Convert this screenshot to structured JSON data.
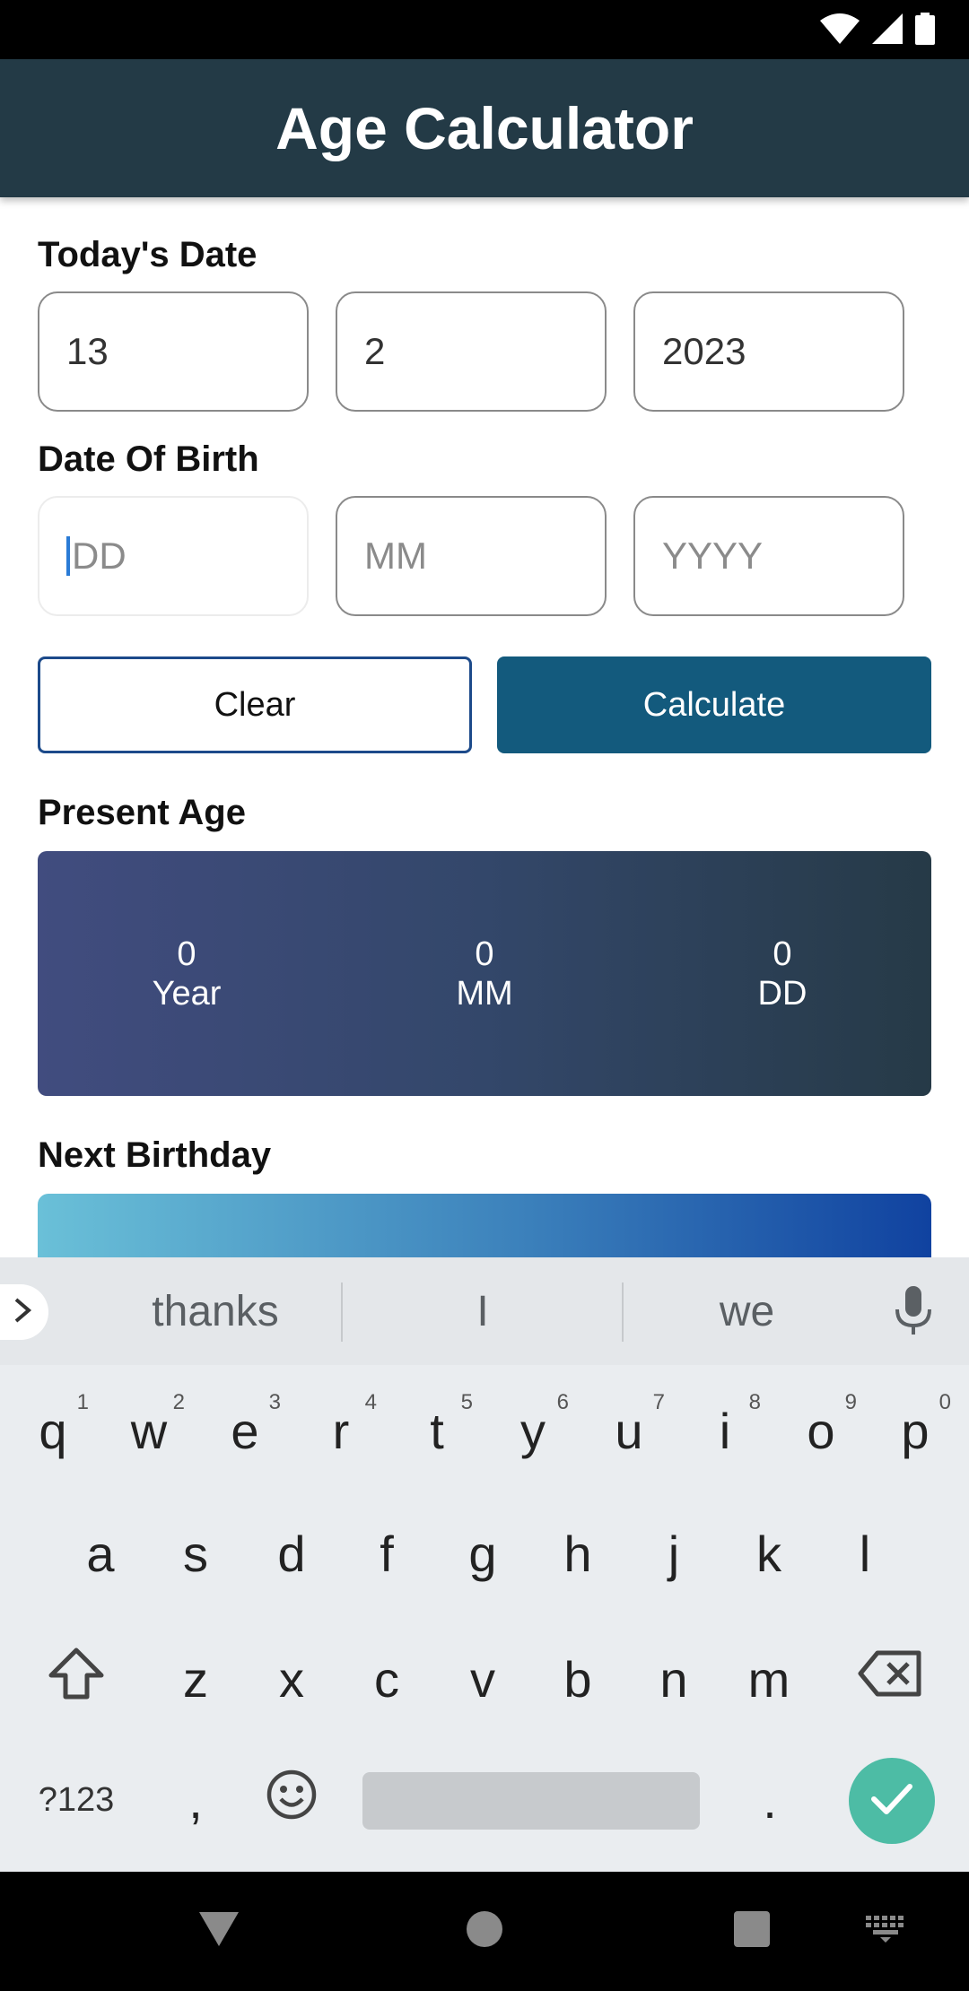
{
  "app": {
    "title": "Age Calculator"
  },
  "todays_date": {
    "label": "Today's Date",
    "day": "13",
    "month": "2",
    "year": "2023"
  },
  "date_of_birth": {
    "label": "Date Of Birth",
    "day_placeholder": "DD",
    "month_placeholder": "MM",
    "year_placeholder": "YYYY"
  },
  "buttons": {
    "clear": "Clear",
    "calculate": "Calculate"
  },
  "present_age": {
    "label": "Present Age",
    "year_value": "0",
    "year_unit": "Year",
    "month_value": "0",
    "month_unit": "MM",
    "day_value": "0",
    "day_unit": "DD"
  },
  "next_birthday": {
    "label": "Next Birthday"
  },
  "keyboard": {
    "suggestions": [
      "thanks",
      "I",
      "we"
    ],
    "row1": [
      "q",
      "w",
      "e",
      "r",
      "t",
      "y",
      "u",
      "i",
      "o",
      "p"
    ],
    "row1_hints": [
      "1",
      "2",
      "3",
      "4",
      "5",
      "6",
      "7",
      "8",
      "9",
      "0"
    ],
    "row2": [
      "a",
      "s",
      "d",
      "f",
      "g",
      "h",
      "j",
      "k",
      "l"
    ],
    "row3": [
      "z",
      "x",
      "c",
      "v",
      "b",
      "n",
      "m"
    ],
    "symbols_key": "?123",
    "comma_key": ",",
    "period_key": "."
  },
  "colors": {
    "app_bar": "#233a46",
    "calculate_button": "#135a7d",
    "clear_border": "#1c4a8a",
    "enter_key": "#4dbca5"
  }
}
